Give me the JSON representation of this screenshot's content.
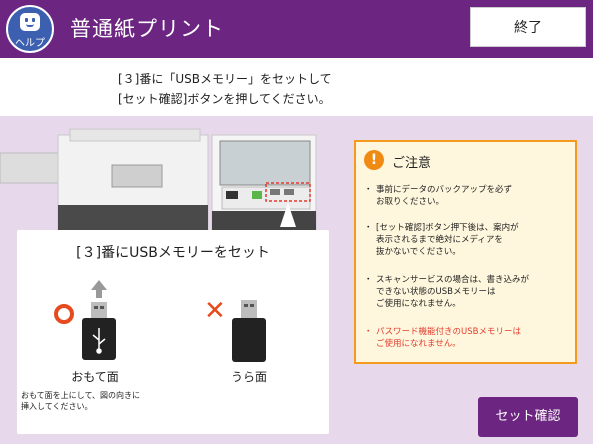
{
  "header": {
    "help_label": "ヘルプ",
    "title": "普通紙プリント",
    "end_label": "終了"
  },
  "instruction": {
    "line1": "[３]番に「USBメモリー」をセットして",
    "line2": "[セット確認]ボタンを押してください。"
  },
  "card": {
    "title": "[３]番にUSBメモリーをセット",
    "front_label": "おもて面",
    "back_label": "うら面",
    "note_line1": "おもて面を上にして、図の向きに",
    "note_line2": "挿入してください。"
  },
  "caution": {
    "title": "ご注意",
    "items": [
      {
        "text": "事前にデータのバックアップを必ず\nお取りください。"
      },
      {
        "text": "[セット確認]ボタン押下後は、案内が\n表示されるまで絶対にメディアを\n抜かないでください。"
      },
      {
        "text": "スキャンサービスの場合は、書き込みが\nできない状態のUSBメモリーは\nご使用になれません。"
      },
      {
        "text": "パスワード機能付きのUSBメモリーは\nご使用になれません。",
        "color": "#e23b2e"
      }
    ]
  },
  "confirm_button": {
    "label": "セット確認"
  },
  "colors": {
    "header": "#6c2580",
    "background": "#e8d8ec",
    "caution_border": "#f29b1f",
    "caution_bg": "#fff7dd",
    "accent_red": "#e54b1e",
    "help_blue": "#3d5fb0"
  },
  "icons": {
    "help": "help-face-icon",
    "caution": "exclamation-icon",
    "ok_mark": "circle-ok-icon",
    "ng_mark": "cross-ng-icon",
    "arrow": "arrow-up-icon",
    "usb": "usb-symbol-icon"
  }
}
